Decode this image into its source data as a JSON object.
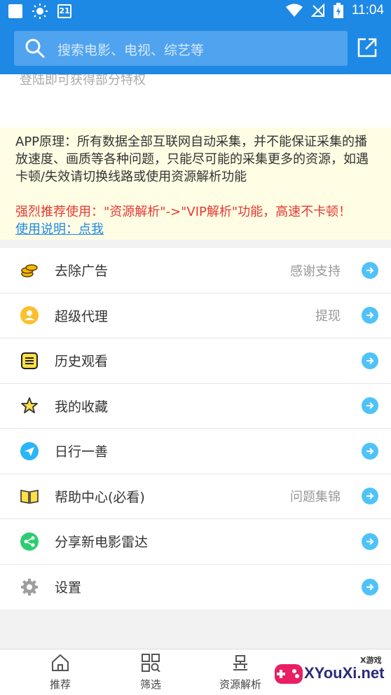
{
  "status_bar": {
    "time": "11:04",
    "calendar_day": "21"
  },
  "header": {
    "search_placeholder": "搜索电影、电视、综艺等"
  },
  "login": {
    "text": "登陆即可获得部分特权"
  },
  "notice": {
    "body": "APP原理：所有数据全部互联网自动采集，并不能保证采集的播放速度、画质等各种问题，只能尽可能的采集更多的资源，如遇卡顿/失效请切换线路或使用资源解析功能",
    "highlight": "强烈推荐使用：\"资源解析\"->\"VIP解析\"功能，高速不卡顿！",
    "link": "使用说明：点我"
  },
  "menu": [
    {
      "label": "去除广告",
      "extra": "感谢支持",
      "icon": "coins-icon"
    },
    {
      "label": "超级代理",
      "extra": "提现",
      "icon": "agent-icon"
    },
    {
      "label": "历史观看",
      "extra": "",
      "icon": "history-icon"
    },
    {
      "label": "我的收藏",
      "extra": "",
      "icon": "star-icon"
    },
    {
      "label": "日行一善",
      "extra": "",
      "icon": "paper-plane-icon"
    },
    {
      "label": "帮助中心(必看)",
      "extra": "问题集锦",
      "icon": "book-icon"
    },
    {
      "label": "分享新电影雷达",
      "extra": "",
      "icon": "share-icon"
    },
    {
      "label": "设置",
      "extra": "",
      "icon": "gear-icon"
    }
  ],
  "bottom_nav": {
    "tabs": [
      {
        "label": "推荐",
        "icon": "home-icon"
      },
      {
        "label": "筛选",
        "icon": "filter-grid-icon"
      },
      {
        "label": "资源解析",
        "icon": "parse-icon"
      }
    ]
  },
  "watermark": {
    "text": "XYouXi.net",
    "small": "X游戏"
  },
  "colors": {
    "primary": "#1e88e5",
    "arrow": "#4fc3f7",
    "notice_bg": "#fffde3",
    "highlight": "#e53935"
  }
}
